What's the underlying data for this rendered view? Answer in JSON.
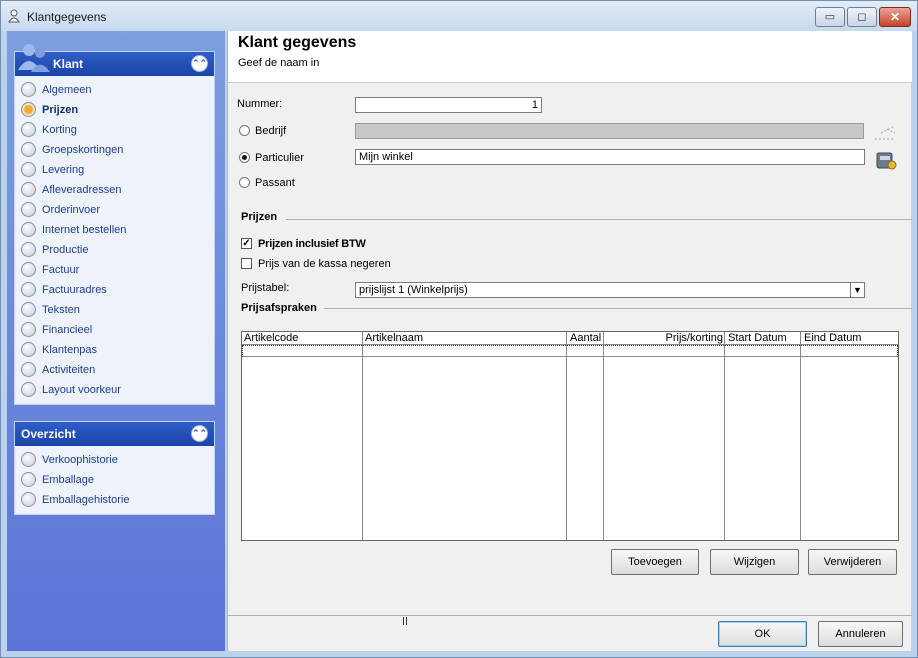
{
  "window": {
    "title": "Klantgegevens"
  },
  "sidebar": {
    "klant": {
      "title": "Klant",
      "items": [
        {
          "label": "Algemeen"
        },
        {
          "label": "Prijzen"
        },
        {
          "label": "Korting"
        },
        {
          "label": "Groepskortingen"
        },
        {
          "label": "Levering"
        },
        {
          "label": "Afleveradressen"
        },
        {
          "label": "Orderinvoer"
        },
        {
          "label": "Internet bestellen"
        },
        {
          "label": "Productie"
        },
        {
          "label": "Factuur"
        },
        {
          "label": "Factuuradres"
        },
        {
          "label": "Teksten"
        },
        {
          "label": "Financieel"
        },
        {
          "label": "Klantenpas"
        },
        {
          "label": "Activiteiten"
        },
        {
          "label": "Layout voorkeur"
        }
      ],
      "active": "Prijzen"
    },
    "overzicht": {
      "title": "Overzicht",
      "items": [
        {
          "label": "Verkoophistorie"
        },
        {
          "label": "Emballage"
        },
        {
          "label": "Emballagehistorie"
        }
      ]
    }
  },
  "header": {
    "title": "Klant gegevens",
    "subtitle": "Geef de naam in"
  },
  "form": {
    "nummer_label": "Nummer:",
    "nummer_value": "1",
    "bedrijf_label": "Bedrijf",
    "bedrijf_value": "",
    "particulier_label": "Particulier",
    "particulier_value": "Mijn winkel",
    "passant_label": "Passant",
    "selected_type": "Particulier"
  },
  "prijzen": {
    "section_title": "Prijzen",
    "incl_btw_label": "Prijzen inclusief BTW",
    "incl_btw_checked": true,
    "kassa_label": "Prijs van de kassa negeren",
    "kassa_checked": false,
    "prijstabel_label": "Prijstabel:",
    "prijstabel_value": "prijslijst 1 (Winkelprijs)"
  },
  "prijsafspraken": {
    "section_title": "Prijsafspraken",
    "columns": [
      "Artikelcode",
      "Artikelnaam",
      "Aantal",
      "Prijs/korting",
      "Start Datum",
      "Eind Datum"
    ],
    "rows": []
  },
  "buttons": {
    "toevoegen": "Toevoegen",
    "wijzigen": "Wijzigen",
    "verwijderen": "Verwijderen",
    "ok": "OK",
    "annuleren": "Annuleren"
  },
  "colors": {
    "sidebar_top": "#7b9fe0",
    "group_header": "#2e5ec6",
    "active_radio": "#f7a83c"
  }
}
